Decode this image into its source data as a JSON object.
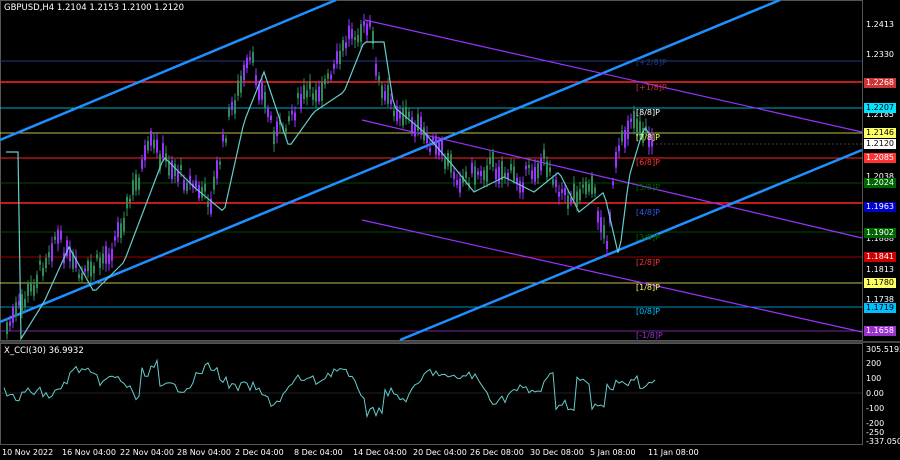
{
  "header": {
    "symbol_title": "GBPUSD,H4  1.2104 1.2153 1.2100 1.2120"
  },
  "cci_panel": {
    "title": "X_CCI(30) 36.9932"
  },
  "price_axis": {
    "plain_labels": [
      "1.2413",
      "1.2330",
      "1.2185",
      "1.2038",
      "1.1888",
      "1.1813",
      "1.1738"
    ],
    "tag_labels": [
      {
        "text": "1.2268",
        "color": "#cc3333"
      },
      {
        "text": "1.2207",
        "color": "#00e5ff"
      },
      {
        "text": "1.2146",
        "color": "#ffff66"
      },
      {
        "text": "1.2120",
        "color": "#ffffff"
      },
      {
        "text": "1.2085",
        "color": "#ff3333"
      },
      {
        "text": "1.2024",
        "color": "#006400"
      },
      {
        "text": "1.1963",
        "color": "#0000cc"
      },
      {
        "text": "1.1902",
        "color": "#006400"
      },
      {
        "text": "1.1841",
        "color": "#cc0000"
      },
      {
        "text": "1.1780",
        "color": "#ffff66"
      },
      {
        "text": "1.1719",
        "color": "#00bfff"
      },
      {
        "text": "1.1658",
        "color": "#9933cc"
      }
    ]
  },
  "murray_labels": [
    "[8/8]P",
    "[7/8]P",
    "[6/8]P",
    "[5/8]P",
    "[4/8]P",
    "[3/8]P",
    "[2/8]P",
    "[1/8]P",
    "[0/8]P",
    "[-1/8]P",
    "[+1/8]P",
    "[+2/8]P"
  ],
  "cci_axis": [
    "305.5192",
    "200",
    "100",
    "0.00",
    "-100",
    "-200",
    "-250",
    "-337.0509"
  ],
  "time_axis": [
    "10 Nov 2022",
    "16 Nov 04:00",
    "22 Nov 04:00",
    "28 Nov 04:00",
    "2 Dec 04:00",
    "8 Dec 04:00",
    "14 Dec 04:00",
    "20 Dec 04:00",
    "26 Dec 08:00",
    "30 Dec 08:00",
    "5 Jan 08:00",
    "11 Jan 08:00"
  ],
  "colors": {
    "background": "#000000",
    "bull_candle": "#9933ff",
    "bear_candle": "#2e8b57",
    "moving_average": "#66cccc",
    "channel": "#1e90ff",
    "trend_line": "#9933ff",
    "cci_line": "#66cccc"
  }
}
